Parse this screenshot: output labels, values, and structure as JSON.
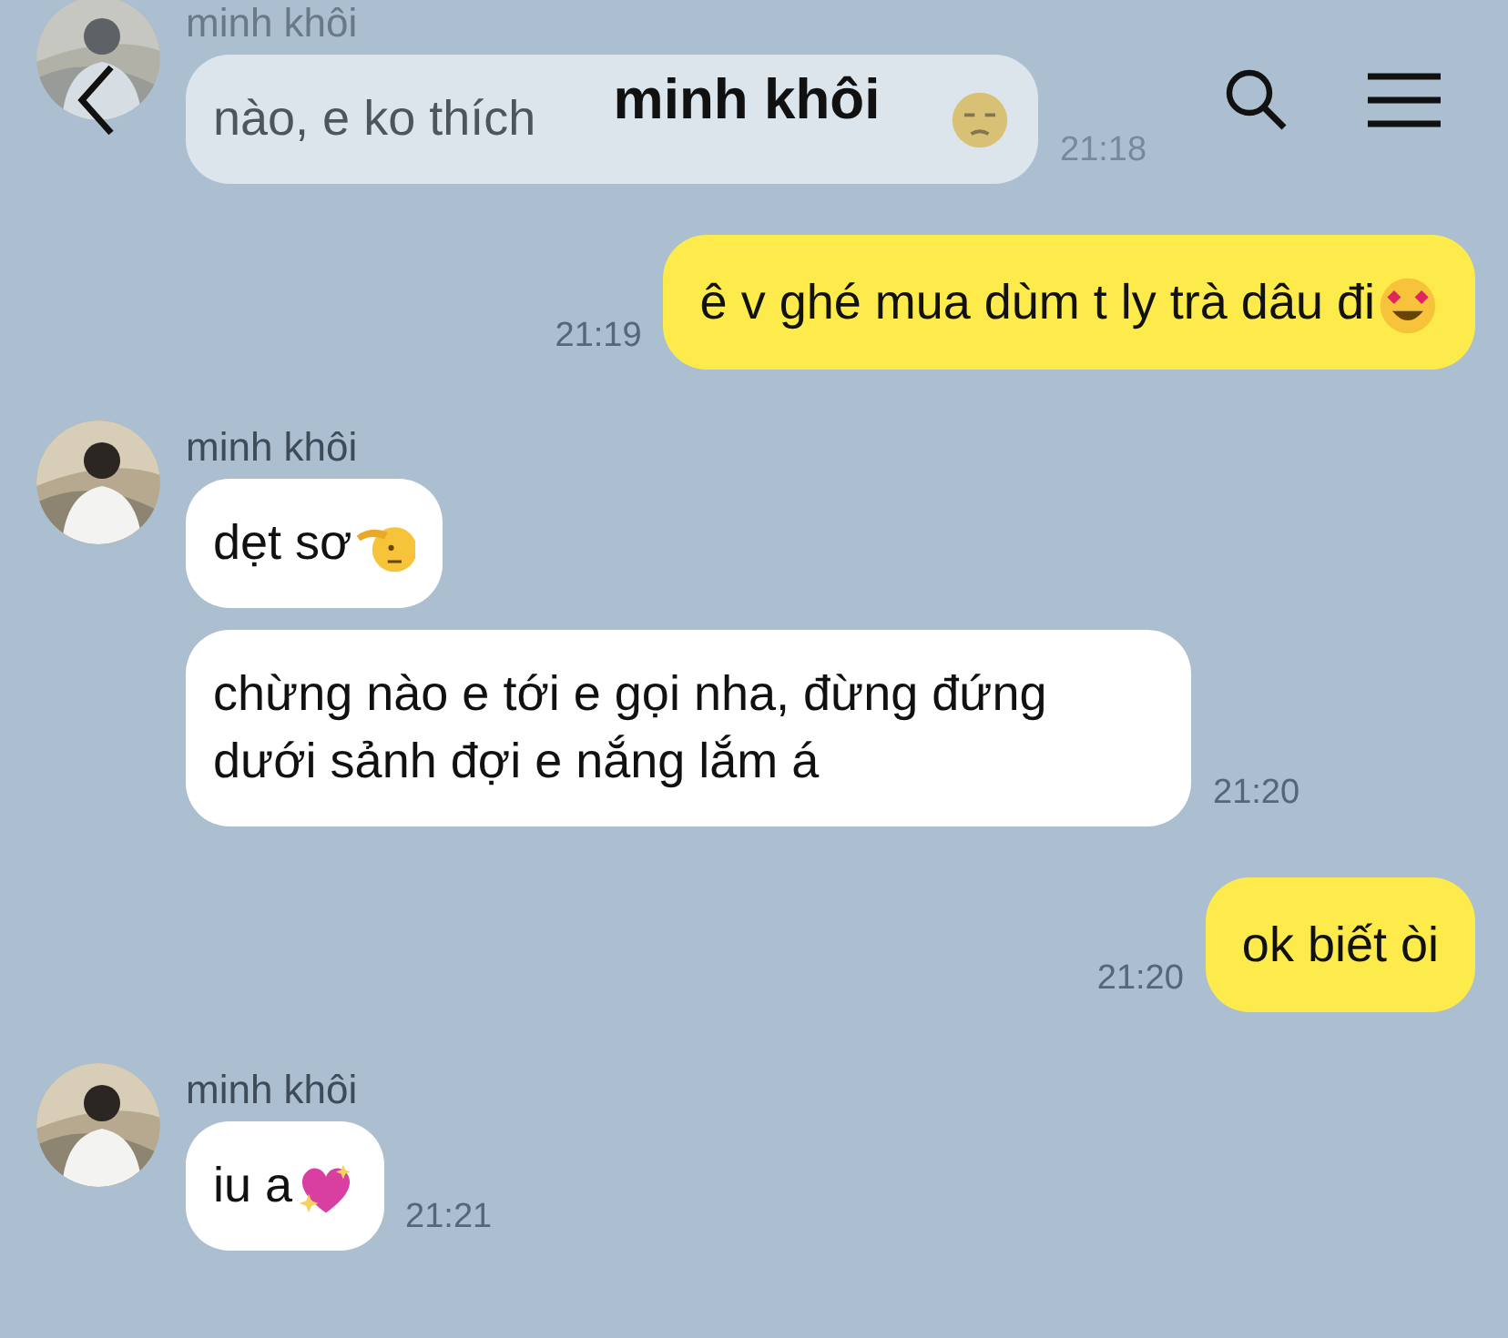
{
  "header": {
    "title": "minh khôi"
  },
  "messages": [
    {
      "kind": "received",
      "faded": true,
      "sender": "minh khôi",
      "bubbles": [
        {
          "text": "nào, e ko thích",
          "kind": "unamused"
        }
      ],
      "time": "21:18"
    },
    {
      "kind": "sent",
      "faded": false,
      "bubbles": [
        {
          "text": "ê v ghé mua dùm t ly trà dâu đi",
          "kind": "heart-eyes"
        }
      ],
      "time": "21:19"
    },
    {
      "kind": "received",
      "faded": false,
      "sender": "minh khôi",
      "bubbles": [
        {
          "text": "dẹt sơ",
          "kind": "salute"
        },
        {
          "text": "chừng nào e tới e gọi nha, đừng đứng dưới sảnh đợi e nắng lắm á"
        }
      ],
      "time": "21:20"
    },
    {
      "kind": "sent",
      "faded": false,
      "bubbles": [
        {
          "text": "ok biết òi"
        }
      ],
      "time": "21:20"
    },
    {
      "kind": "received",
      "faded": false,
      "sender": "minh khôi",
      "bubbles": [
        {
          "text": "iu a",
          "kind": "sparkling-heart"
        }
      ],
      "time": "21:21"
    }
  ]
}
